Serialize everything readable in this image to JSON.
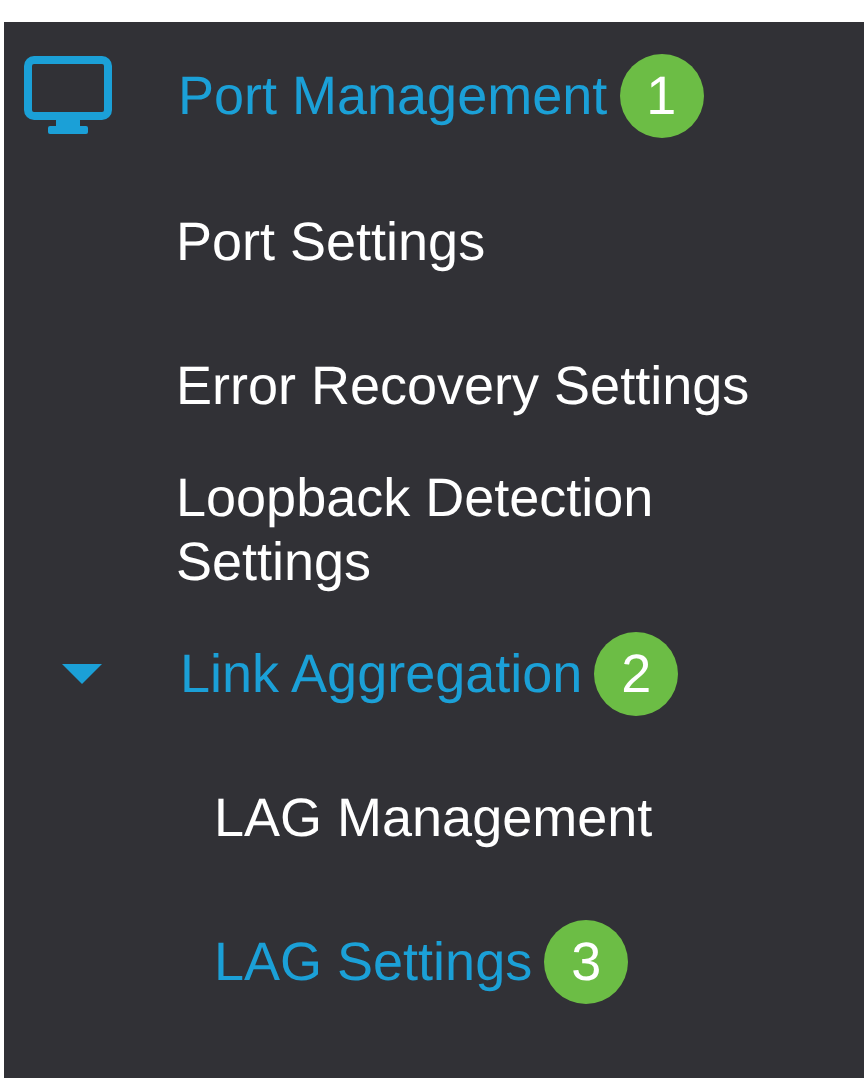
{
  "sidebar": {
    "section": {
      "label": "Port Management",
      "badge": "1",
      "children": [
        {
          "label": "Port Settings",
          "selected": false
        },
        {
          "label": "Error Recovery Settings",
          "selected": false
        },
        {
          "label": "Loopback Detection Settings",
          "selected": false
        },
        {
          "label": "Link Aggregation",
          "expanded": true,
          "badge": "2",
          "children": [
            {
              "label": "LAG Management",
              "selected": false
            },
            {
              "label": "LAG Settings",
              "selected": true,
              "badge": "3"
            }
          ]
        }
      ]
    }
  }
}
